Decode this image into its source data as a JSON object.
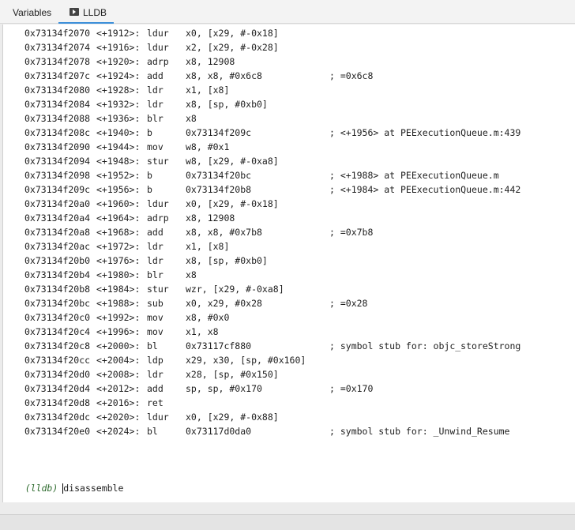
{
  "tabs": [
    {
      "label": "Variables"
    },
    {
      "label": "LLDB",
      "icon": "terminal-icon",
      "active": true
    }
  ],
  "accent_color": "#3b8fd9",
  "prompt_color": "#2e6b2e",
  "lines": [
    {
      "addr": "0x73134f2070",
      "off": "<+1912>:",
      "mn": "ldur",
      "op": "x0, [x29, #-0x18]",
      "cm": ""
    },
    {
      "addr": "0x73134f2074",
      "off": "<+1916>:",
      "mn": "ldur",
      "op": "x2, [x29, #-0x28]",
      "cm": ""
    },
    {
      "addr": "0x73134f2078",
      "off": "<+1920>:",
      "mn": "adrp",
      "op": "x8, 12908",
      "cm": ""
    },
    {
      "addr": "0x73134f207c",
      "off": "<+1924>:",
      "mn": "add",
      "op": "x8, x8, #0x6c8",
      "cm": "; =0x6c8"
    },
    {
      "addr": "0x73134f2080",
      "off": "<+1928>:",
      "mn": "ldr",
      "op": "x1, [x8]",
      "cm": ""
    },
    {
      "addr": "0x73134f2084",
      "off": "<+1932>:",
      "mn": "ldr",
      "op": "x8, [sp, #0xb0]",
      "cm": ""
    },
    {
      "addr": "0x73134f2088",
      "off": "<+1936>:",
      "mn": "blr",
      "op": "x8",
      "cm": ""
    },
    {
      "addr": "0x73134f208c",
      "off": "<+1940>:",
      "mn": "b",
      "op": "0x73134f209c",
      "cm": "; <+1956> at PEExecutionQueue.m:439"
    },
    {
      "addr": "0x73134f2090",
      "off": "<+1944>:",
      "mn": "mov",
      "op": "w8, #0x1",
      "cm": ""
    },
    {
      "addr": "0x73134f2094",
      "off": "<+1948>:",
      "mn": "stur",
      "op": "w8, [x29, #-0xa8]",
      "cm": ""
    },
    {
      "addr": "0x73134f2098",
      "off": "<+1952>:",
      "mn": "b",
      "op": "0x73134f20bc",
      "cm": "; <+1988> at PEExecutionQueue.m"
    },
    {
      "addr": "0x73134f209c",
      "off": "<+1956>:",
      "mn": "b",
      "op": "0x73134f20b8",
      "cm": "; <+1984> at PEExecutionQueue.m:442"
    },
    {
      "addr": "0x73134f20a0",
      "off": "<+1960>:",
      "mn": "ldur",
      "op": "x0, [x29, #-0x18]",
      "cm": ""
    },
    {
      "addr": "0x73134f20a4",
      "off": "<+1964>:",
      "mn": "adrp",
      "op": "x8, 12908",
      "cm": ""
    },
    {
      "addr": "0x73134f20a8",
      "off": "<+1968>:",
      "mn": "add",
      "op": "x8, x8, #0x7b8",
      "cm": "; =0x7b8"
    },
    {
      "addr": "0x73134f20ac",
      "off": "<+1972>:",
      "mn": "ldr",
      "op": "x1, [x8]",
      "cm": ""
    },
    {
      "addr": "0x73134f20b0",
      "off": "<+1976>:",
      "mn": "ldr",
      "op": "x8, [sp, #0xb0]",
      "cm": ""
    },
    {
      "addr": "0x73134f20b4",
      "off": "<+1980>:",
      "mn": "blr",
      "op": "x8",
      "cm": ""
    },
    {
      "addr": "0x73134f20b8",
      "off": "<+1984>:",
      "mn": "stur",
      "op": "wzr, [x29, #-0xa8]",
      "cm": ""
    },
    {
      "addr": "0x73134f20bc",
      "off": "<+1988>:",
      "mn": "sub",
      "op": "x0, x29, #0x28",
      "cm": "; =0x28"
    },
    {
      "addr": "0x73134f20c0",
      "off": "<+1992>:",
      "mn": "mov",
      "op": "x8, #0x0",
      "cm": ""
    },
    {
      "addr": "0x73134f20c4",
      "off": "<+1996>:",
      "mn": "mov",
      "op": "x1, x8",
      "cm": ""
    },
    {
      "addr": "0x73134f20c8",
      "off": "<+2000>:",
      "mn": "bl",
      "op": "0x73117cf880",
      "cm": "; symbol stub for: objc_storeStrong"
    },
    {
      "addr": "0x73134f20cc",
      "off": "<+2004>:",
      "mn": "ldp",
      "op": "x29, x30, [sp, #0x160]",
      "cm": ""
    },
    {
      "addr": "0x73134f20d0",
      "off": "<+2008>:",
      "mn": "ldr",
      "op": "x28, [sp, #0x150]",
      "cm": ""
    },
    {
      "addr": "0x73134f20d4",
      "off": "<+2012>:",
      "mn": "add",
      "op": "sp, sp, #0x170",
      "cm": "; =0x170"
    },
    {
      "addr": "0x73134f20d8",
      "off": "<+2016>:",
      "mn": "ret",
      "op": "",
      "cm": ""
    },
    {
      "addr": "0x73134f20dc",
      "off": "<+2020>:",
      "mn": "ldur",
      "op": "x0, [x29, #-0x88]",
      "cm": ""
    },
    {
      "addr": "0x73134f20e0",
      "off": "<+2024>:",
      "mn": "bl",
      "op": "0x73117d0da0",
      "cm": "; symbol stub for: _Unwind_Resume"
    }
  ],
  "console": {
    "prompt": "(lldb)",
    "input": "disassemble"
  }
}
